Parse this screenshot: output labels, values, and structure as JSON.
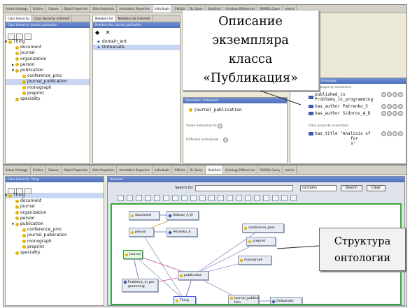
{
  "back_window": {
    "tabs": [
      "Active Ontology",
      "Entities",
      "Classes",
      "Object Properties",
      "Data Properties",
      "Annotation Properties",
      "Individuals",
      "OWLViz",
      "DL Query",
      "OntoGraf",
      "Ontology Differences",
      "SPARQL Query",
      "matrix"
    ],
    "active_tab_index": 6,
    "class_panel": {
      "subtabs": [
        "Class hierarchy",
        "Class hierarchy (inferred)"
      ],
      "header": "Class hierarchy: journal_publication",
      "tree": [
        {
          "label": "Thing",
          "level": 0,
          "expander": "▼"
        },
        {
          "label": "document",
          "level": 1
        },
        {
          "label": "journal",
          "level": 1
        },
        {
          "label": "organization",
          "level": 1
        },
        {
          "label": "person",
          "level": 1,
          "expander": "▶"
        },
        {
          "label": "publication",
          "level": 1,
          "expander": "▼"
        },
        {
          "label": "conference_proc",
          "level": 2
        },
        {
          "label": "journal_publication",
          "level": 2,
          "selected": true
        },
        {
          "label": "monograph",
          "level": 2
        },
        {
          "label": "preprint",
          "level": 2
        },
        {
          "label": "speciality",
          "level": 1
        }
      ]
    },
    "members_panel": {
      "subtabs": [
        "Members list",
        "Members list (inferred)"
      ],
      "header": "Members list: journal_publication",
      "items": [
        "domain_ent",
        "Ontoanalis"
      ],
      "selected_item": 1
    },
    "description_panel": {
      "header": "Description: Ontoanalis",
      "types_value": "journal_publication",
      "same_individual_label": "Same Individual As",
      "different_individuals_label": "Different Individuals"
    },
    "property_panel": {
      "header": "Property assertions: Ontoanalis",
      "object_label": "Object property assertions",
      "object_assertions": [
        "published_in Problems_in_programming",
        "has_author Patrenko_S",
        "has_author Sidorov_A_D"
      ],
      "data_label": "Data property assertions",
      "data_assertion_lines": [
        "has_title \"Analisis of",
        "for",
        "s\""
      ]
    }
  },
  "callouts": {
    "instance_description": [
      "Описание",
      "экземпляра",
      "класса",
      "«Публикация»"
    ],
    "ontology_structure": [
      "Структура",
      "онтологии"
    ]
  },
  "front_window": {
    "tabs": [
      "Active Ontology",
      "Entities",
      "Classes",
      "Object Properties",
      "Data Properties",
      "Annotation Properties",
      "Individuals",
      "OWLViz",
      "DL Query",
      "OntoGraf",
      "Ontology Differences",
      "SPARQL Query",
      "matrix"
    ],
    "active_tab_index": 9,
    "class_panel": {
      "header": "Class hierarchy: Thing",
      "tree": [
        {
          "label": "Thing",
          "level": 0,
          "expander": "▼",
          "selected": true
        },
        {
          "label": "document",
          "level": 1
        },
        {
          "label": "journal",
          "level": 1
        },
        {
          "label": "organization",
          "level": 1
        },
        {
          "label": "person",
          "level": 1
        },
        {
          "label": "publication",
          "level": 1,
          "expander": "▼"
        },
        {
          "label": "conference_proc",
          "level": 2
        },
        {
          "label": "journal_publication",
          "level": 2
        },
        {
          "label": "monograph",
          "level": 2
        },
        {
          "label": "preprint",
          "level": 2
        },
        {
          "label": "speciality",
          "level": 1
        }
      ]
    },
    "ontograf": {
      "header": "OntoGraf",
      "search_label": "Search for",
      "mode_value": "contains",
      "search_button": "Search",
      "clear_button": "Clear",
      "nodes": [
        {
          "id": "document",
          "label": "document",
          "kind": "class"
        },
        {
          "id": "sidorov",
          "label": "Sidorov_A_D",
          "kind": "instance"
        },
        {
          "id": "person",
          "label": "person",
          "kind": "class"
        },
        {
          "id": "petrenko",
          "label": "Petrenko_S",
          "kind": "instance"
        },
        {
          "id": "conference",
          "label": "conference_proc",
          "kind": "class"
        },
        {
          "id": "preprint",
          "label": "preprint",
          "kind": "class"
        },
        {
          "id": "journal",
          "label": "journal",
          "kind": "class",
          "highlight": "green"
        },
        {
          "id": "monograph",
          "label": "monograph",
          "kind": "class"
        },
        {
          "id": "publication",
          "label": "publication",
          "kind": "class"
        },
        {
          "id": "problems",
          "label": "Problems_in_pro gramming",
          "kind": "instance"
        },
        {
          "id": "thing",
          "label": "Thing",
          "kind": "class",
          "highlight": "blue"
        },
        {
          "id": "journal_pub",
          "label": "journal_publica tion",
          "kind": "class"
        },
        {
          "id": "ontoanalis",
          "label": "Ontoanalis",
          "kind": "instance"
        }
      ]
    }
  },
  "colors": {
    "tab_header": "#5577c4",
    "class_dot": "#e6b400",
    "instance_mark": "#3c5ab0",
    "canvas_border": "#3aa83a"
  }
}
